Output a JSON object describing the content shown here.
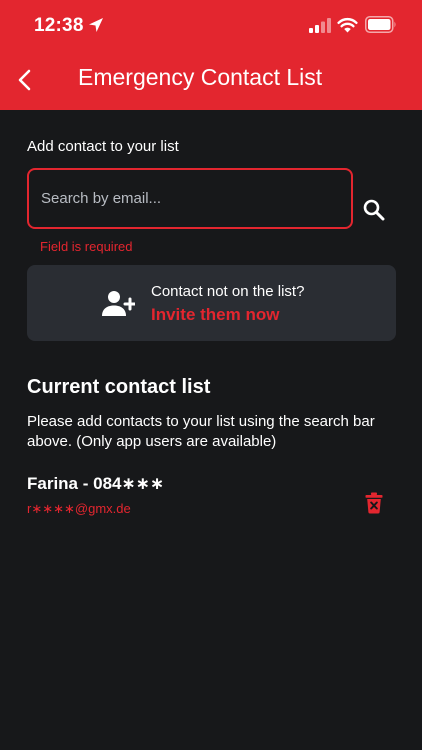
{
  "status_bar": {
    "time": "12:38",
    "icons": [
      "location-arrow-icon",
      "signal-icon",
      "wifi-icon",
      "battery-icon"
    ]
  },
  "header": {
    "title": "Emergency Contact List",
    "back_icon": "chevron-left-icon"
  },
  "search": {
    "label": "Add contact to your list",
    "placeholder": "Search by email...",
    "value": "",
    "error": "Field is required",
    "search_icon": "search-icon"
  },
  "invite": {
    "prompt": "Contact not on the list?",
    "link": "Invite them now",
    "icon": "person-add-icon"
  },
  "contact_list": {
    "heading": "Current contact list",
    "info": "Please add contacts to your list using the search bar above. (Only app users are available)",
    "items": [
      {
        "name": "Farina - 084∗∗∗",
        "email": "r∗∗∗∗@gmx.de",
        "delete_icon": "trash-icon"
      }
    ]
  },
  "colors": {
    "accent": "#e3262f",
    "background": "#17181a",
    "card": "#2a2d33",
    "text": "#ffffff",
    "placeholder": "#b8bcc3"
  }
}
